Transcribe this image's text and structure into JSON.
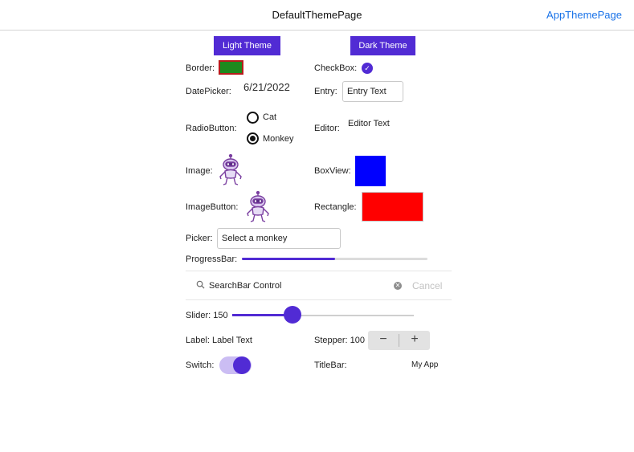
{
  "window": {
    "title": "DefaultThemePage",
    "nav_link": "AppThemePage"
  },
  "theme_buttons": {
    "light": "Light Theme",
    "dark": "Dark Theme"
  },
  "controls": {
    "border_label": "Border:",
    "checkbox_label": "CheckBox:",
    "checkbox_checked": true,
    "datepicker_label": "DatePicker:",
    "date_value": "6/21/2022",
    "entry_label": "Entry:",
    "entry_value": "Entry Text",
    "radio_label": "RadioButton:",
    "radio_options": [
      {
        "label": "Cat",
        "checked": false
      },
      {
        "label": "Monkey",
        "checked": true
      }
    ],
    "editor_label": "Editor:",
    "editor_value": "Editor Text",
    "image_label": "Image:",
    "image_icon": "dotnet-bot-icon",
    "boxview_label": "BoxView:",
    "imagebutton_label": "ImageButton:",
    "rectangle_label": "Rectangle:",
    "picker_label": "Picker:",
    "picker_value": "Select a monkey",
    "progressbar_label": "ProgressBar:",
    "progress": 0.5,
    "search_placeholder": "SearchBar Control",
    "search_cancel": "Cancel",
    "slider_label": "Slider: 150",
    "slider_value": 150,
    "slider_min": 0,
    "slider_max": 450,
    "label_label": "Label: Label Text",
    "stepper_label": "Stepper: 100",
    "stepper_minus": "−",
    "stepper_plus": "+",
    "switch_label": "Switch:",
    "switch_on": true,
    "titlebar_label": "TitleBar:",
    "titlebar_value": "My App"
  },
  "colors": {
    "accent": "#512bd4",
    "border_outer": "#b71c1c",
    "border_inner": "#1e8a1e",
    "boxview": "#0000ff",
    "rectangle": "#ff0000",
    "link": "#1a73e8"
  }
}
